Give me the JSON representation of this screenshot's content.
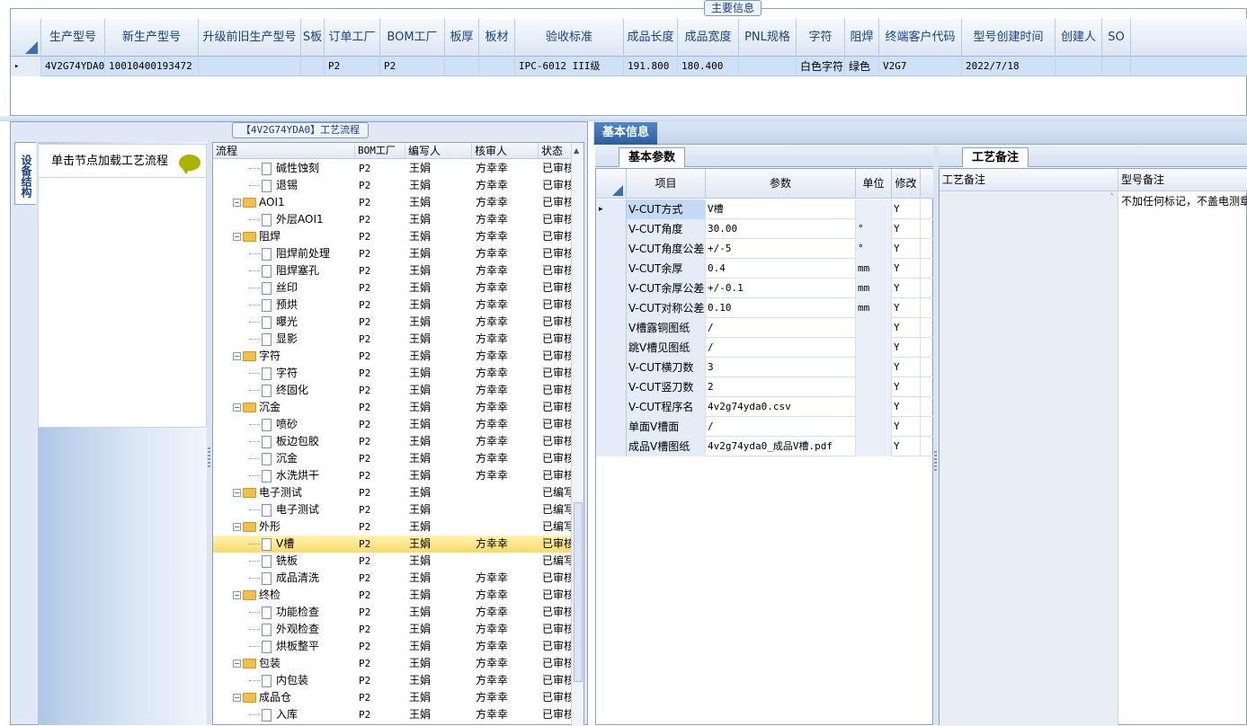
{
  "main_info": {
    "title": "主要信息",
    "columns": [
      "生产型号",
      "新生产型号",
      "升级前旧生产型号",
      "S板",
      "订单工厂",
      "BOM工厂",
      "板厚",
      "板材",
      "验收标准",
      "成品长度",
      "成品宽度",
      "PNL规格",
      "字符",
      "阻焊",
      "终端客户代码",
      "型号创建时间",
      "创建人",
      "SO"
    ],
    "row": {
      "marker": "▸",
      "cells": [
        "4V2G74YDA0",
        "10010400193472",
        "",
        "",
        "P2",
        "P2",
        "",
        "",
        "IPC-6012 III级",
        "191.800",
        "180.400",
        "",
        "白色字符",
        "绿色",
        "V2G7",
        "2022/7/18",
        "",
        ""
      ]
    }
  },
  "process": {
    "title": "【4V2G74YDA0】工艺流程",
    "side_tab": "设备结构",
    "side_item": "单击节点加载工艺流程",
    "tree_columns": [
      "流程",
      "BOM工厂",
      "编写人",
      "核审人",
      "状态"
    ],
    "rows": [
      {
        "type": "leaf",
        "name": "碱性蚀刻",
        "bom": "P2",
        "writer": "王娟",
        "reviewer": "方幸幸",
        "status": "已审核"
      },
      {
        "type": "leaf",
        "name": "退锡",
        "bom": "P2",
        "writer": "王娟",
        "reviewer": "方幸幸",
        "status": "已审核"
      },
      {
        "type": "group",
        "name": "AOI1",
        "bom": "P2",
        "writer": "王娟",
        "reviewer": "方幸幸",
        "status": "已审核"
      },
      {
        "type": "leaf",
        "name": "外层AOI1",
        "bom": "P2",
        "writer": "王娟",
        "reviewer": "方幸幸",
        "status": "已审核"
      },
      {
        "type": "group",
        "name": "阻焊",
        "bom": "P2",
        "writer": "王娟",
        "reviewer": "方幸幸",
        "status": "已审核"
      },
      {
        "type": "leaf",
        "name": "阻焊前处理",
        "bom": "P2",
        "writer": "王娟",
        "reviewer": "方幸幸",
        "status": "已审核"
      },
      {
        "type": "leaf",
        "name": "阻焊塞孔",
        "bom": "P2",
        "writer": "王娟",
        "reviewer": "方幸幸",
        "status": "已审核"
      },
      {
        "type": "leaf",
        "name": "丝印",
        "bom": "P2",
        "writer": "王娟",
        "reviewer": "方幸幸",
        "status": "已审核"
      },
      {
        "type": "leaf",
        "name": "预烘",
        "bom": "P2",
        "writer": "王娟",
        "reviewer": "方幸幸",
        "status": "已审核"
      },
      {
        "type": "leaf",
        "name": "曝光",
        "bom": "P2",
        "writer": "王娟",
        "reviewer": "方幸幸",
        "status": "已审核"
      },
      {
        "type": "leaf",
        "name": "显影",
        "bom": "P2",
        "writer": "王娟",
        "reviewer": "方幸幸",
        "status": "已审核"
      },
      {
        "type": "group",
        "name": "字符",
        "bom": "P2",
        "writer": "王娟",
        "reviewer": "方幸幸",
        "status": "已审核"
      },
      {
        "type": "leaf",
        "name": "字符",
        "bom": "P2",
        "writer": "王娟",
        "reviewer": "方幸幸",
        "status": "已审核"
      },
      {
        "type": "leaf",
        "name": "终固化",
        "bom": "P2",
        "writer": "王娟",
        "reviewer": "方幸幸",
        "status": "已审核"
      },
      {
        "type": "group",
        "name": "沉金",
        "bom": "P2",
        "writer": "王娟",
        "reviewer": "方幸幸",
        "status": "已审核"
      },
      {
        "type": "leaf",
        "name": "喷砂",
        "bom": "P2",
        "writer": "王娟",
        "reviewer": "方幸幸",
        "status": "已审核"
      },
      {
        "type": "leaf",
        "name": "板边包胶",
        "bom": "P2",
        "writer": "王娟",
        "reviewer": "方幸幸",
        "status": "已审核"
      },
      {
        "type": "leaf",
        "name": "沉金",
        "bom": "P2",
        "writer": "王娟",
        "reviewer": "方幸幸",
        "status": "已审核"
      },
      {
        "type": "leaf",
        "name": "水洗烘干",
        "bom": "P2",
        "writer": "王娟",
        "reviewer": "方幸幸",
        "status": "已审核"
      },
      {
        "type": "group",
        "name": "电子测试",
        "bom": "P2",
        "writer": "王娟",
        "reviewer": "",
        "status": "已编写"
      },
      {
        "type": "leaf",
        "name": "电子测试",
        "bom": "P2",
        "writer": "王娟",
        "reviewer": "",
        "status": "已编写"
      },
      {
        "type": "group",
        "name": "外形",
        "bom": "P2",
        "writer": "王娟",
        "reviewer": "",
        "status": "已编写"
      },
      {
        "type": "leaf",
        "name": "V槽",
        "bom": "P2",
        "writer": "王娟",
        "reviewer": "方幸幸",
        "status": "已审核",
        "selected": true
      },
      {
        "type": "leaf",
        "name": "铣板",
        "bom": "P2",
        "writer": "王娟",
        "reviewer": "",
        "status": "已编写"
      },
      {
        "type": "leaf",
        "name": "成品清洗",
        "bom": "P2",
        "writer": "王娟",
        "reviewer": "方幸幸",
        "status": "已审核"
      },
      {
        "type": "group",
        "name": "终检",
        "bom": "P2",
        "writer": "王娟",
        "reviewer": "方幸幸",
        "status": "已审核"
      },
      {
        "type": "leaf",
        "name": "功能检查",
        "bom": "P2",
        "writer": "王娟",
        "reviewer": "方幸幸",
        "status": "已审核"
      },
      {
        "type": "leaf",
        "name": "外观检查",
        "bom": "P2",
        "writer": "王娟",
        "reviewer": "方幸幸",
        "status": "已审核"
      },
      {
        "type": "leaf",
        "name": "烘板整平",
        "bom": "P2",
        "writer": "王娟",
        "reviewer": "方幸幸",
        "status": "已审核"
      },
      {
        "type": "group",
        "name": "包装",
        "bom": "P2",
        "writer": "王娟",
        "reviewer": "方幸幸",
        "status": "已审核"
      },
      {
        "type": "leaf",
        "name": "内包装",
        "bom": "P2",
        "writer": "王娟",
        "reviewer": "方幸幸",
        "status": "已审核"
      },
      {
        "type": "group",
        "name": "成品仓",
        "bom": "P2",
        "writer": "王娟",
        "reviewer": "方幸幸",
        "status": "已审核"
      },
      {
        "type": "leaf",
        "name": "入库",
        "bom": "P2",
        "writer": "王娟",
        "reviewer": "方幸幸",
        "status": "已审核"
      }
    ]
  },
  "basic": {
    "tab": "基本信息",
    "subtab": "基本参数",
    "columns": [
      "项目",
      "参数",
      "单位",
      "修改"
    ],
    "rows": [
      {
        "item": "V-CUT方式",
        "param": "V槽",
        "unit": "",
        "mod": "Y",
        "current": true
      },
      {
        "item": "V-CUT角度",
        "param": "30.00",
        "unit": "°",
        "mod": "Y"
      },
      {
        "item": "V-CUT角度公差",
        "param": "+/-5",
        "unit": "°",
        "mod": "Y"
      },
      {
        "item": "V-CUT余厚",
        "param": "0.4",
        "unit": "mm",
        "mod": "Y"
      },
      {
        "item": "V-CUT余厚公差",
        "param": "+/-0.1",
        "unit": "mm",
        "mod": "Y"
      },
      {
        "item": "V-CUT对称公差",
        "param": "0.10",
        "unit": "mm",
        "mod": "Y"
      },
      {
        "item": "V槽露铜图纸",
        "param": "/",
        "unit": "",
        "mod": "Y"
      },
      {
        "item": "跳V槽见图纸",
        "param": "/",
        "unit": "",
        "mod": "Y"
      },
      {
        "item": "V-CUT横刀数",
        "param": "3",
        "unit": "",
        "mod": "Y"
      },
      {
        "item": "V-CUT竖刀数",
        "param": "2",
        "unit": "",
        "mod": "Y"
      },
      {
        "item": "V-CUT程序名",
        "param": "4v2g74yda0.csv",
        "unit": "",
        "mod": "Y"
      },
      {
        "item": "单面V槽面",
        "param": "/",
        "unit": "",
        "mod": "Y"
      },
      {
        "item": "成品V槽图纸",
        "param": "4v2g74yda0_成品V槽.pdf",
        "unit": "",
        "mod": "Y"
      }
    ]
  },
  "notes": {
    "subtab": "工艺备注",
    "columns": [
      "工艺备注",
      "型号备注"
    ],
    "model_note": "不加任何标记，不盖电测章"
  }
}
